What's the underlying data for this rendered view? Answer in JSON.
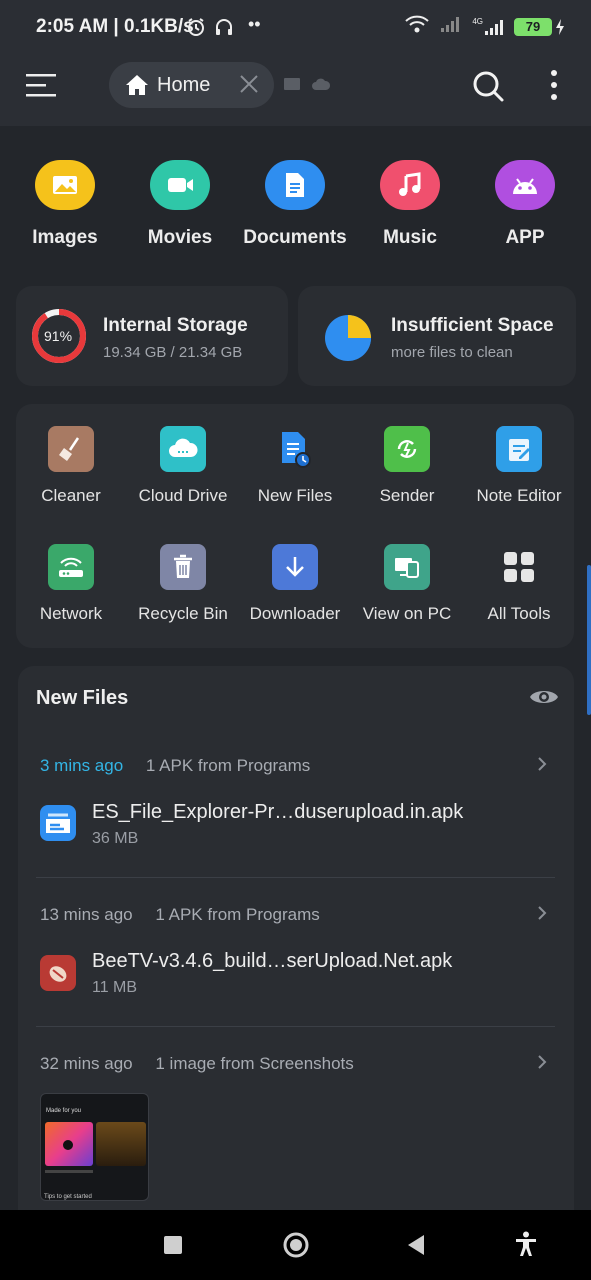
{
  "status": {
    "time_speed": "2:05 AM | 0.1KB/s",
    "network": "4G",
    "battery": "79"
  },
  "appbar": {
    "home_label": "Home"
  },
  "categories": [
    {
      "label": "Images",
      "color": "#f5c21b",
      "icon": "image-icon"
    },
    {
      "label": "Movies",
      "color": "#2fc7a8",
      "icon": "video-icon"
    },
    {
      "label": "Documents",
      "color": "#2f8ef0",
      "icon": "document-icon"
    },
    {
      "label": "Music",
      "color": "#f0506e",
      "icon": "music-icon"
    },
    {
      "label": "APP",
      "color": "#b04fe0",
      "icon": "android-icon"
    }
  ],
  "storage": {
    "internal": {
      "title": "Internal Storage",
      "sub": "19.34 GB / 21.34 GB",
      "percent_label": "91%",
      "percent": 91
    },
    "clean": {
      "title": "Insufficient Space",
      "sub": "more files to clean"
    }
  },
  "tools": [
    {
      "label": "Cleaner",
      "color": "#a87a63",
      "icon": "broom-icon"
    },
    {
      "label": "Cloud Drive",
      "color": "#2fc0c8",
      "icon": "cloud-icon"
    },
    {
      "label": "New Files",
      "color": "#2f8ef0",
      "icon": "new-files-icon"
    },
    {
      "label": "Sender",
      "color": "#4fbf4a",
      "icon": "sender-icon"
    },
    {
      "label": "Note Editor",
      "color": "#2f9fe8",
      "icon": "note-icon"
    },
    {
      "label": "Network",
      "color": "#3aa86a",
      "icon": "router-icon"
    },
    {
      "label": "Recycle Bin",
      "color": "#7f86a6",
      "icon": "trash-icon"
    },
    {
      "label": "Downloader",
      "color": "#4d79d8",
      "icon": "download-icon"
    },
    {
      "label": "View on PC",
      "color": "#3fa48a",
      "icon": "monitor-icon"
    },
    {
      "label": "All Tools",
      "color": "#e6e6e6",
      "icon": "grid-icon"
    }
  ],
  "new_files": {
    "title": "New Files",
    "groups": [
      {
        "ago": "3 mins ago",
        "desc": "1 APK from Programs",
        "file": "ES_File_Explorer-Pr…duserupload.in.apk",
        "size": "36 MB"
      },
      {
        "ago": "13 mins ago",
        "desc": "1 APK from Programs",
        "file": "BeeTV-v3.4.6_build…serUpload.Net.apk",
        "size": "11 MB"
      },
      {
        "ago": "32 mins ago",
        "desc": "1 image from Screenshots",
        "thumb_title": "Made for you",
        "thumb_footer": "Tips to get started"
      }
    ]
  }
}
